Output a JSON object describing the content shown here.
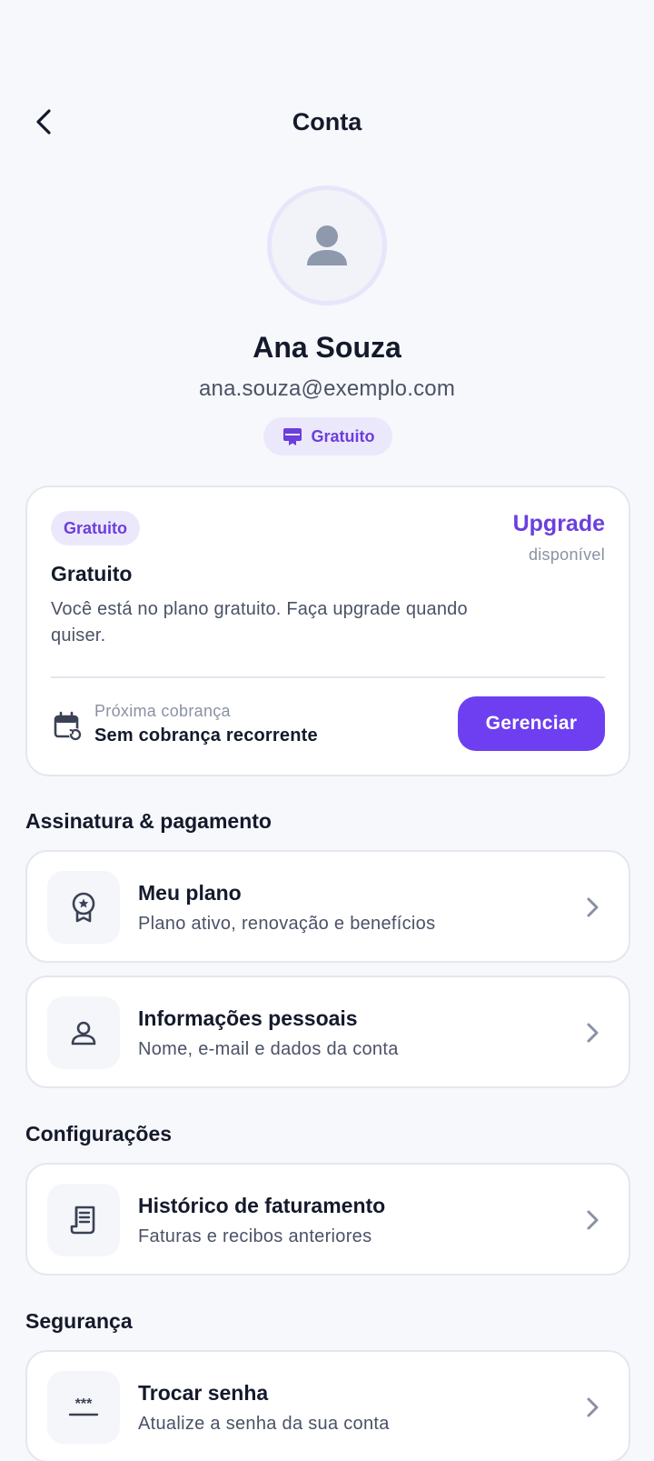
{
  "header": {
    "title": "Conta"
  },
  "profile": {
    "name": "Ana Souza",
    "email": "ana.souza@exemplo.com",
    "plan_pill": "Gratuito"
  },
  "plan_card": {
    "badge": "Gratuito",
    "upgrade_title": "Upgrade",
    "upgrade_sub": "disponível",
    "name": "Gratuito",
    "description": "Você está no plano gratuito. Faça upgrade quando quiser.",
    "billing_label": "Próxima cobrança",
    "billing_value": "Sem cobrança recorrente",
    "manage_label": "Gerenciar"
  },
  "sections": [
    {
      "title": "Assinatura & pagamento",
      "items": [
        {
          "title": "Meu plano",
          "subtitle": "Plano ativo, renovação e benefícios",
          "icon": "award-icon"
        },
        {
          "title": "Informações pessoais",
          "subtitle": "Nome, e-mail e dados da conta",
          "icon": "user-icon"
        }
      ]
    },
    {
      "title": "Configurações",
      "items": [
        {
          "title": "Histórico de faturamento",
          "subtitle": "Faturas e recibos anteriores",
          "icon": "receipt-icon"
        }
      ]
    },
    {
      "title": "Segurança",
      "items": [
        {
          "title": "Trocar senha",
          "subtitle": "Atualize a senha da sua conta",
          "icon": "password-icon"
        }
      ]
    }
  ],
  "colors": {
    "accent": "#6e3ff0",
    "accent_text": "#6b3fdd",
    "accent_soft": "#ece8fc",
    "background": "#f7f8fb",
    "text_primary": "#141a2b",
    "text_secondary": "#4b5266",
    "text_muted": "#8a91a3",
    "border": "#e4e7ee"
  }
}
